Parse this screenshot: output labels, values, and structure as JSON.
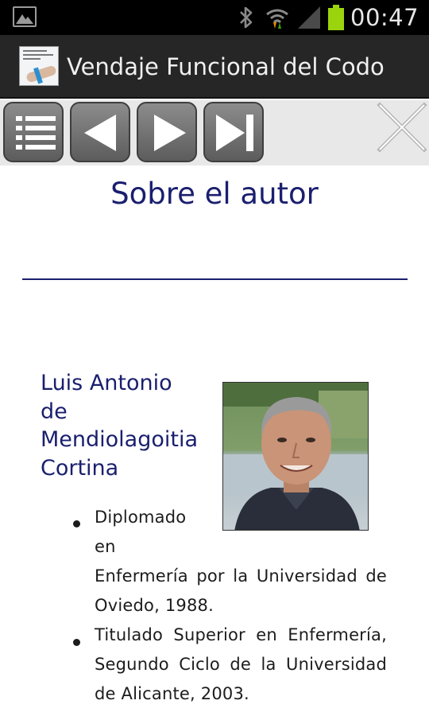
{
  "status_bar": {
    "time": "00:47",
    "icons": [
      "image-notification-icon",
      "bluetooth-icon",
      "wifi-icon",
      "signal-icon",
      "battery-icon"
    ],
    "battery_color": "#9bd40c"
  },
  "app_bar": {
    "title": "Vendaje Funcional del Codo",
    "icon": "app-icon"
  },
  "toolbar": {
    "buttons": [
      "index-icon",
      "previous-icon",
      "next-icon",
      "last-page-icon"
    ],
    "close": "close-icon"
  },
  "content": {
    "heading": "Sobre el autor",
    "author": {
      "name_lines": [
        "Luis Antonio",
        "de",
        "Mendiolagoitia",
        "Cortina"
      ]
    },
    "bullets": [
      {
        "lines": [
          "Diplomado",
          "en",
          "Enfermería por la Universidad de",
          "Oviedo, 1988."
        ]
      },
      {
        "lines": [
          "Titulado Superior en Enfermería,",
          "Segundo Ciclo de la Universidad",
          "de Alicante, 2003."
        ]
      }
    ]
  },
  "colors": {
    "heading": "#1a1f6e",
    "toolbar_bg": "#e8e8e8",
    "title_bar_bg": "#262626"
  }
}
